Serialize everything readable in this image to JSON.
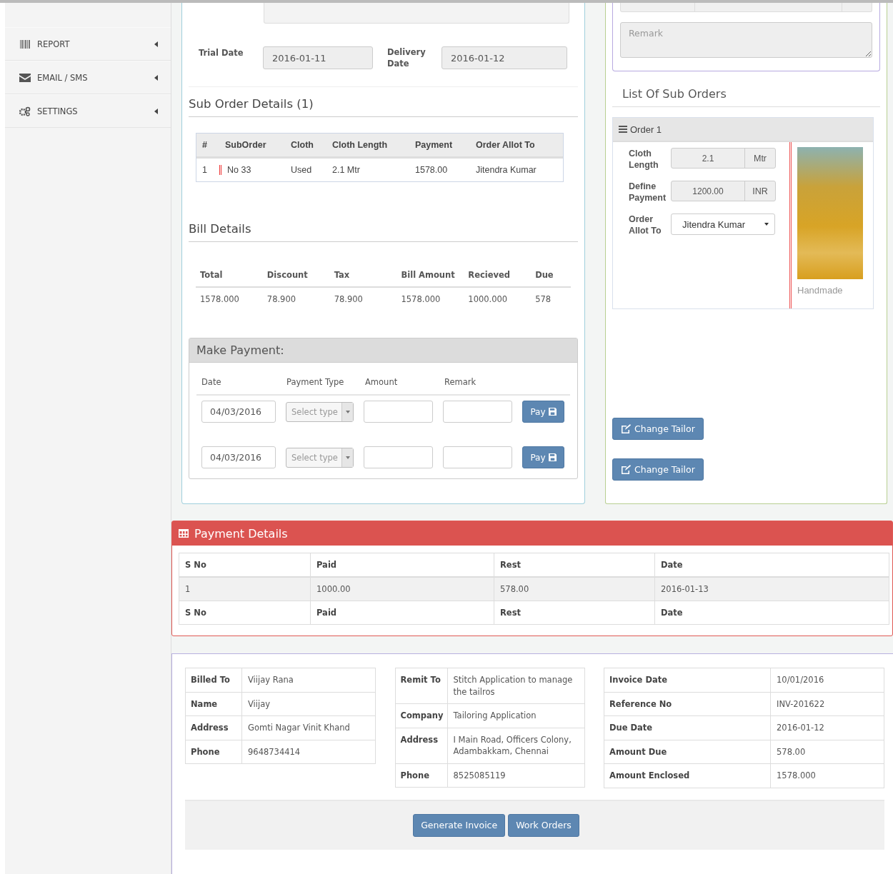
{
  "sidebar": {
    "items": [
      {
        "label": "REPORT"
      },
      {
        "label": "EMAIL / SMS"
      },
      {
        "label": "SETTINGS"
      }
    ]
  },
  "order_form": {
    "trial_label": "Trial Date",
    "trial_value": "2016-01-11",
    "delivery_label": "Delivery Date",
    "delivery_value": "2016-01-12"
  },
  "sub_orders": {
    "title": "Sub Order Details (1)",
    "columns": [
      "#",
      "SubOrder",
      "Cloth",
      "Cloth Length",
      "Payment",
      "Order Allot To"
    ],
    "rows": [
      [
        "1",
        "No 33",
        "Used",
        "2.1 Mtr",
        "1578.00",
        "Jitendra Kumar"
      ]
    ]
  },
  "bill": {
    "title": "Bill Details",
    "columns": [
      "Total",
      "Discount",
      "Tax",
      "Bill Amount",
      "Recieved",
      "Due"
    ],
    "rows": [
      [
        "1578.000",
        "78.900",
        "78.900",
        "1578.000",
        "1000.000",
        "578"
      ]
    ]
  },
  "make_payment": {
    "title": "Make Payment:",
    "columns": [
      "Date",
      "Payment Type",
      "Amount",
      "Remark"
    ],
    "rows": [
      {
        "date": "04/03/2016",
        "type_placeholder": "Select type",
        "button": "Pay"
      },
      {
        "date": "04/03/2016",
        "type_placeholder": "Select type",
        "button": "Pay"
      }
    ]
  },
  "right_panel": {
    "remark_placeholder": "Remark",
    "list_title": "List Of Sub Orders",
    "order": {
      "title": "Order 1",
      "fields": [
        {
          "kind": "unit",
          "label": "Cloth Length",
          "value": "2.1",
          "unit": "Mtr"
        },
        {
          "kind": "unit",
          "label": "Define Payment",
          "value": "1200.00",
          "unit": "INR"
        },
        {
          "kind": "select",
          "label": "Order Allot To",
          "value": "Jitendra Kumar"
        }
      ],
      "caption": "Handmade"
    },
    "buttons": [
      "Change Tailor",
      "Change Tailor"
    ]
  },
  "payment_details": {
    "title": "Payment Details",
    "columns": [
      "S No",
      "Paid",
      "Rest",
      "Date"
    ],
    "rows": [
      [
        "1",
        "1000.00",
        "578.00",
        "2016-01-13"
      ]
    ],
    "footer": [
      "S No",
      "Paid",
      "Rest",
      "Date"
    ]
  },
  "invoice": {
    "billed": [
      {
        "label": "Billed To",
        "value": "Viijay Rana"
      },
      {
        "label": "Name",
        "value": "Viijay"
      },
      {
        "label": "Address",
        "value": "Gomti Nagar Vinit Khand"
      },
      {
        "label": "Phone",
        "value": "9648734414"
      }
    ],
    "remit": [
      {
        "label": "Remit To",
        "value": "Stitch Application to manage the tailros"
      },
      {
        "label": "Company",
        "value": "Tailoring Application"
      },
      {
        "label": "Address",
        "value": "I Main Road, Officers Colony, Adambakkam, Chennai"
      },
      {
        "label": "Phone",
        "value": "8525085119"
      }
    ],
    "meta": [
      {
        "label": "Invoice Date",
        "value": "10/01/2016"
      },
      {
        "label": "Reference No",
        "value": "INV-201622"
      },
      {
        "label": "Due Date",
        "value": "2016-01-12"
      },
      {
        "label": "Amount Due",
        "value": "578.00"
      },
      {
        "label": "Amount Enclosed",
        "value": "1578.000"
      }
    ],
    "actions": [
      "Generate Invoice",
      "Work Orders"
    ]
  }
}
